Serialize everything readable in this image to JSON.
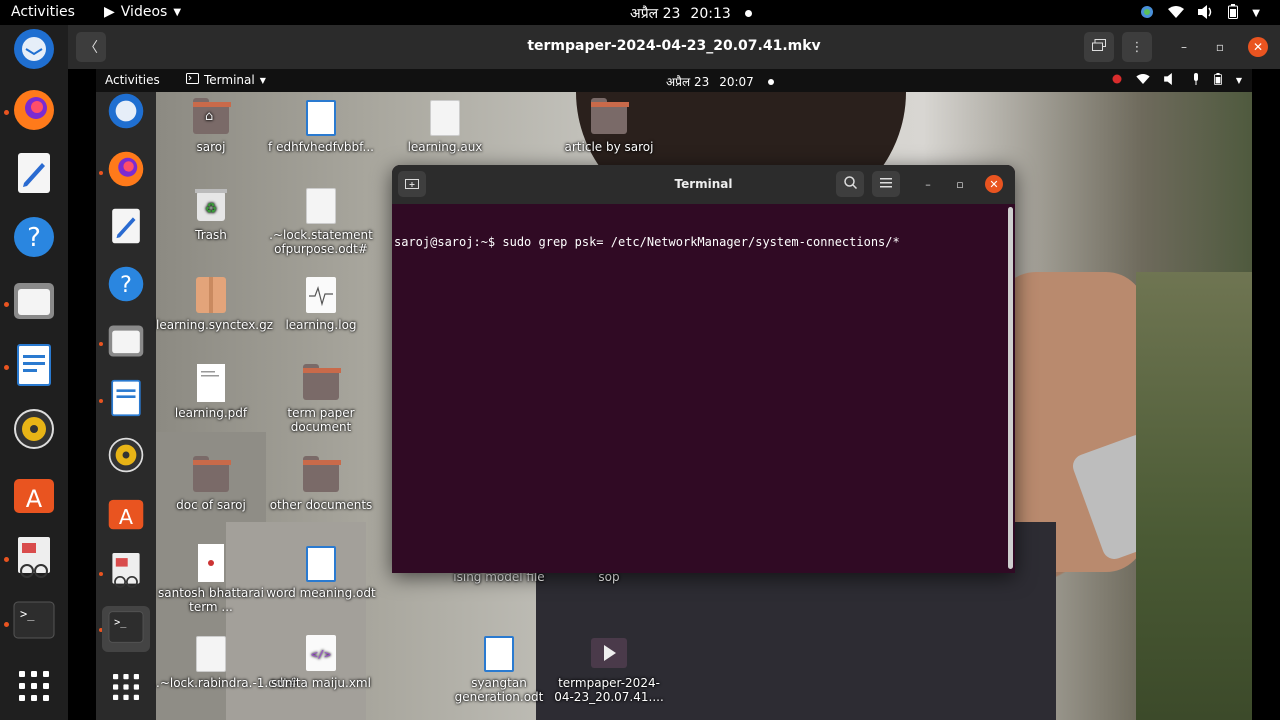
{
  "outer_topbar": {
    "activities": "Activities",
    "app_name": "Videos",
    "date": "अप्रैल 23",
    "time": "20:13"
  },
  "player": {
    "title": "termpaper-2024-04-23_20.07.41.mkv"
  },
  "inner_topbar": {
    "activities": "Activities",
    "app_name": "Terminal",
    "date": "अप्रैल 23",
    "time": "20:07"
  },
  "desktop_icons": {
    "saroj": "saroj",
    "f_file": "f edhfvhedfvbbf...",
    "learning_aux": "learning.aux",
    "article": "article by saroj",
    "trash": "Trash",
    "lock_statement": ".~lock.statement ofpurpose.odt#",
    "synctex": "learning.synctex.gz",
    "learning_log": "learning.log",
    "learning_pdf": "learning.pdf",
    "term_paper_doc": "term paper document",
    "doc_of_saroj": "doc of saroj",
    "other_docs": "other documents",
    "santosh": "santosh bhattarai term ...",
    "word_meaning": "word meaning.odt",
    "ising": "ising model file",
    "sop": "sop",
    "lock_rabindra": ".~lock.rabindra.-1.odt#",
    "sunita": "sunita maiju.xml",
    "syangtan": "syangtan generation.odt",
    "termpaper_vid": "termpaper-2024-04-23_20.07.41...."
  },
  "terminal": {
    "title": "Terminal",
    "line1": "saroj@saroj:~$ sudo grep psk= /etc/NetworkManager/system-connections/*"
  },
  "colors": {
    "terminal_bg": "#300a24",
    "accent": "#e95420"
  }
}
